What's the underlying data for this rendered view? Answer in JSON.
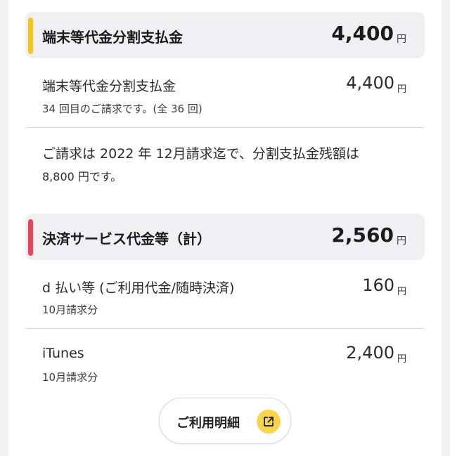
{
  "colors": {
    "accent_device": "#f5c518",
    "accent_payment": "#e8445a",
    "button_icon_bg": "#f8d54a"
  },
  "device_section": {
    "title": "端末等代金分割支払金",
    "amount": "4,400",
    "yen": "円",
    "row": {
      "label": "端末等代金分割支払金",
      "amount": "4,400",
      "yen": "円",
      "sub": "34 回目のご請求です。(全 36 回)"
    },
    "note_line1": "ご請求は 2022 年 12月請求迄で、分割支払金残額は",
    "note_line2": "8,800 円です。"
  },
  "payment_section": {
    "title": "決済サービス代金等（計）",
    "amount": "2,560",
    "yen": "円",
    "rows": [
      {
        "label": "d 払い等 (ご利用代金/随時決済)",
        "amount": "160",
        "yen": "円",
        "sub": "10月請求分"
      },
      {
        "label": "iTunes",
        "amount": "2,400",
        "yen": "円",
        "sub": "10月請求分"
      }
    ]
  },
  "detail_button": {
    "label": "ご利用明細",
    "icon": "external-link-icon"
  }
}
